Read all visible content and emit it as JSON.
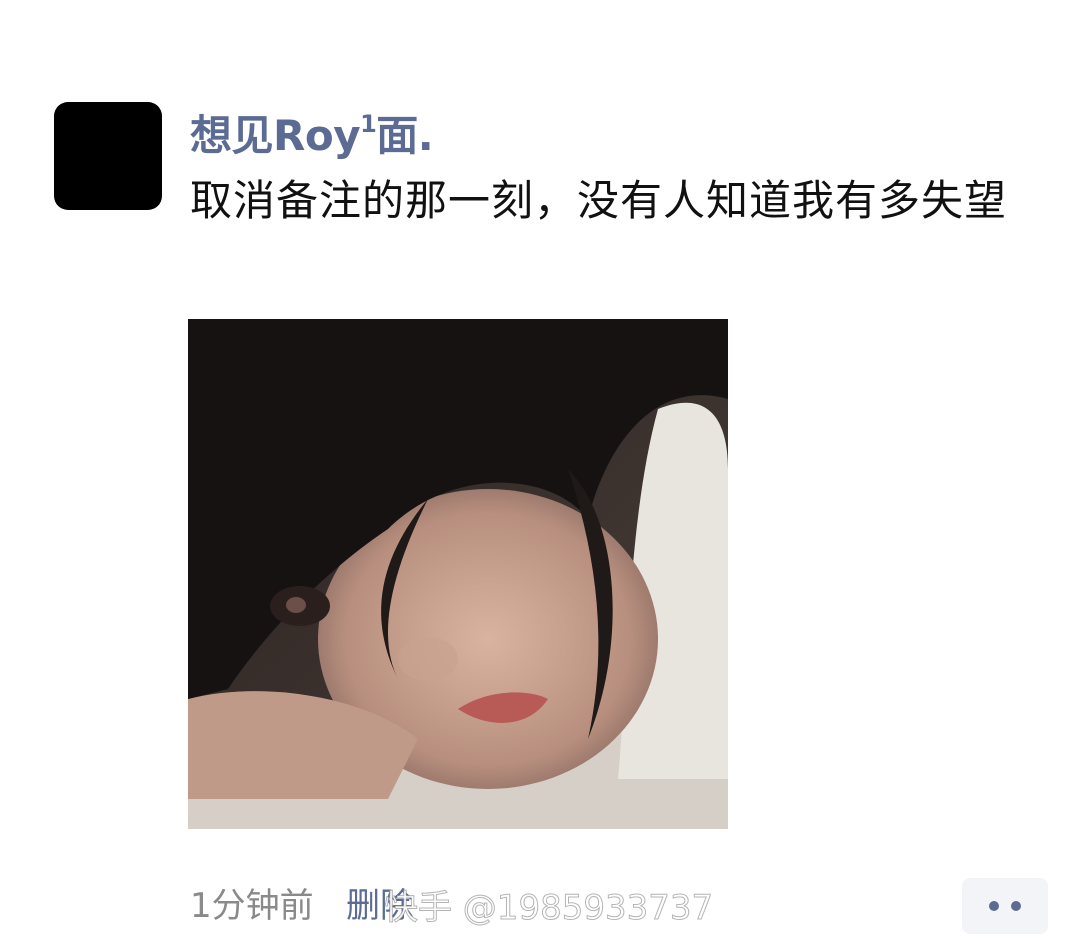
{
  "post": {
    "username": "想见Roy",
    "username_sup": "1",
    "username_tail": "面.",
    "text": "取消备注的那一刻，没有人知道我有多失望",
    "image_alt": "girl-lying-down-photo"
  },
  "footer": {
    "time": "1分钟前",
    "delete_label": "删除",
    "more_icon": "more-dots-icon"
  },
  "watermark": {
    "text": "快手 @1985933737"
  },
  "colors": {
    "name": "#5b6b93",
    "text": "#111111",
    "meta": "#8a8a8a",
    "more_bg": "#f3f4f7"
  }
}
